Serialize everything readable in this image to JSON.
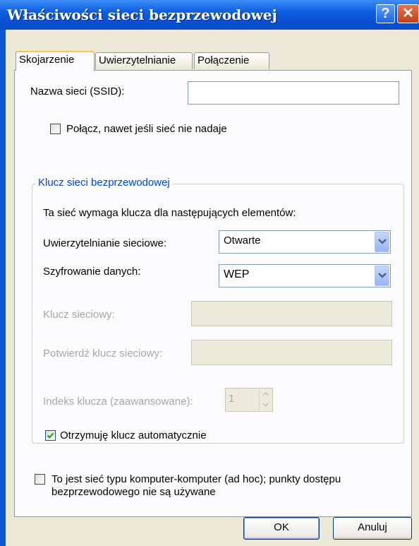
{
  "window": {
    "title": "Właściwości sieci bezprzewodowej",
    "help_glyph": "?",
    "close_glyph": "✕"
  },
  "tabs": [
    {
      "label": "Skojarzenie",
      "active": true
    },
    {
      "label": "Uwierzytelnianie",
      "active": false
    },
    {
      "label": "Połączenie",
      "active": false
    }
  ],
  "association": {
    "ssid_label": "Nazwa sieci (SSID):",
    "ssid_value": "",
    "connect_even_if_not_broadcasting_label": "Połącz, nawet jeśli sieć nie nadaje",
    "connect_even_if_not_broadcasting_checked": false,
    "key_group_title": "Klucz sieci bezprzewodowej",
    "key_required_text": "Ta sieć wymaga klucza dla następujących elementów:",
    "network_auth_label": "Uwierzytelnianie sieciowe:",
    "network_auth_value": "Otwarte",
    "data_encryption_label": "Szyfrowanie danych:",
    "data_encryption_value": "WEP",
    "network_key_label": "Klucz sieciowy:",
    "confirm_key_label": "Potwierdź klucz sieciowy:",
    "key_index_label": "Indeks klucza (zaawansowane):",
    "key_index_value": "1",
    "key_provided_auto_label": "Otrzymuję klucz automatycznie",
    "key_provided_auto_checked": true,
    "adhoc_label_line1": "To jest sieć typu komputer-komputer (ad hoc); punkty dostępu",
    "adhoc_label_line2": "bezprzewodowego nie są używane",
    "adhoc_checked": false
  },
  "buttons": {
    "ok": "OK",
    "cancel": "Anuluj"
  },
  "colors": {
    "titlebar": "#0a58d8",
    "dialog_face": "#ece9d8",
    "group_title": "#0046d5",
    "disabled_text": "#a7a6aa",
    "check_mark": "#21a121"
  }
}
